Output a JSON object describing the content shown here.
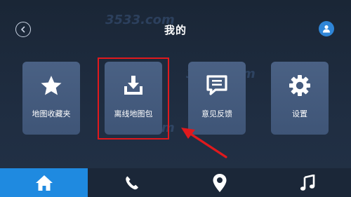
{
  "header": {
    "title": "我的",
    "back_icon": "chevron-left-icon",
    "user_icon": "user-icon"
  },
  "tiles": [
    {
      "label": "地图收藏夹",
      "icon": "star-icon"
    },
    {
      "label": "离线地图包",
      "icon": "download-icon",
      "highlighted": true
    },
    {
      "label": "意见反馈",
      "icon": "feedback-icon"
    },
    {
      "label": "设置",
      "icon": "gear-icon"
    }
  ],
  "bottom_nav": [
    {
      "icon": "home-icon",
      "active": true
    },
    {
      "icon": "phone-icon",
      "active": false
    },
    {
      "icon": "map-pin-icon",
      "active": false
    },
    {
      "icon": "music-icon",
      "active": false
    }
  ],
  "watermark": {
    "text": "3533.com"
  },
  "colors": {
    "background": "#1e2b3e",
    "tile": "#455b7e",
    "accent": "#1f8ae0",
    "highlight": "#e0191d"
  }
}
